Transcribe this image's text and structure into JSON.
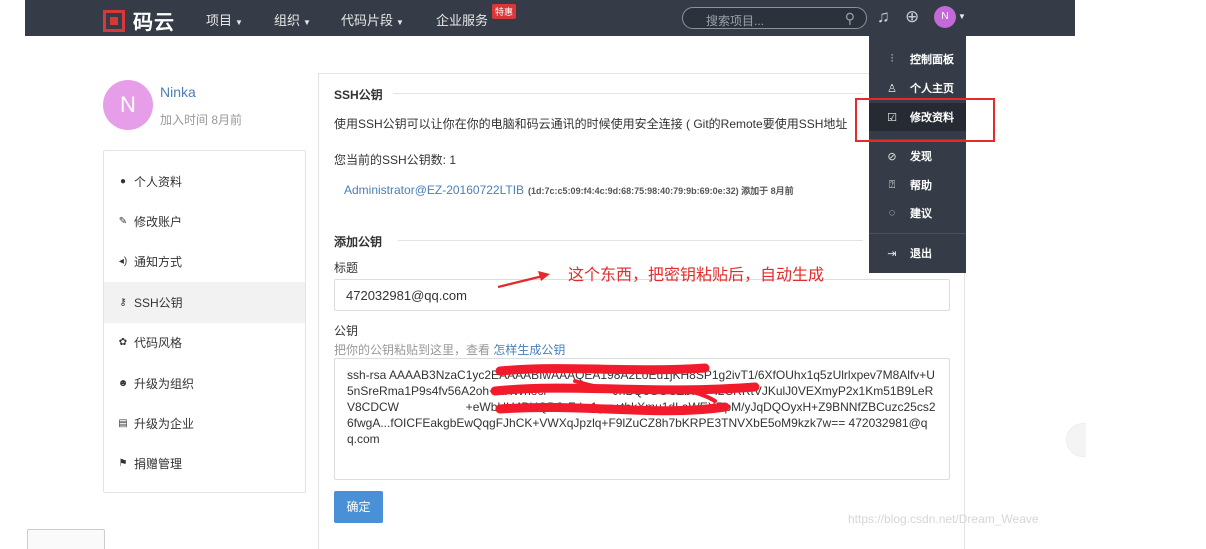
{
  "nav": {
    "logo_text": "码云",
    "items": [
      "项目",
      "组织",
      "代码片段",
      "企业服务"
    ],
    "hot_badge": "特惠",
    "search_placeholder": "搜索项目...",
    "avatar_initial": "N"
  },
  "dropdown": {
    "items": [
      {
        "label": "控制面板",
        "icon": "dashboard-icon"
      },
      {
        "label": "个人主页",
        "icon": "user-icon"
      },
      {
        "label": "修改资料",
        "icon": "edit-icon"
      },
      {
        "label": "发现",
        "icon": "compass-icon"
      },
      {
        "label": "帮助",
        "icon": "help-icon"
      },
      {
        "label": "建议",
        "icon": "chat-icon"
      },
      {
        "label": "退出",
        "icon": "logout-icon"
      }
    ],
    "active_index": 2
  },
  "profile": {
    "initial": "N",
    "name": "Ninka",
    "join_time": "加入时间 8月前"
  },
  "sidebar": {
    "items": [
      {
        "label": "个人资料",
        "icon": "person-icon"
      },
      {
        "label": "修改账户",
        "icon": "pencil-icon"
      },
      {
        "label": "通知方式",
        "icon": "speaker-icon"
      },
      {
        "label": "SSH公钥",
        "icon": "key-icon"
      },
      {
        "label": "代码风格",
        "icon": "style-icon"
      },
      {
        "label": "升级为组织",
        "icon": "group-icon"
      },
      {
        "label": "升级为企业",
        "icon": "building-icon"
      },
      {
        "label": "捐赠管理",
        "icon": "gift-icon"
      }
    ],
    "active_index": 3
  },
  "ssh": {
    "section_title": "SSH公钥",
    "description": "使用SSH公钥可以让你在你的电脑和码云通讯的时候使用安全连接 ( Git的Remote要使用SSH地址",
    "count_label": "您当前的SSH公钥数: 1",
    "existing_key_name": "Administrator@EZ-20160722LTIB",
    "existing_key_meta": "(1d:7c:c5:09:f4:4c:9d:68:75:98:40:79:9b:69:0e:32) 添加于 8月前"
  },
  "add_key": {
    "section_title": "添加公钥",
    "title_label": "标题",
    "title_value": "472032981@qq.com",
    "key_label": "公钥",
    "key_hint": "把你的公钥粘贴到这里，查看 ",
    "key_hint_link": "怎样生成公钥",
    "key_value": "ssh-rsa AAAAB3NzaC1yc2EAAAABIwAAAQEA198A2LoEu1jKH8SP1g2ivT1/6XfOUhx1q5zUlrlxpev7M8Alfv+U5nSreRma1P9s4fv56A2oh+AHWhocl                    JnBQ6GOCZbwV+I2CRRtVJKulJ0VEXmyP2x1Km51B9LeRV8CDCW                    +eWbUH4BHQDJcFdw1gm+thkXmu1dLaWEXRpM/yJqDQOyxH+Z9BNNfZBCuzc25cs26fwgA...fOICFEakgbEwQqgFJhCK+VWXqJpzlq+F9lZuCZ8h7bKRPE3TNVXbE5oM9kzk7w== 472032981@qq.com",
    "submit_label": "确定"
  },
  "annotation": "这个东西，把密钥粘贴后，自动生成",
  "watermark": "https://blog.csdn.net/Dream_Weave",
  "colors": {
    "nav_bg": "#353c47",
    "brand_red": "#d93838",
    "link_blue": "#4a7fb7",
    "button_blue": "#4a90d6",
    "annotation_red": "#e22b2b",
    "avatar_purple": "#e79ee8"
  }
}
